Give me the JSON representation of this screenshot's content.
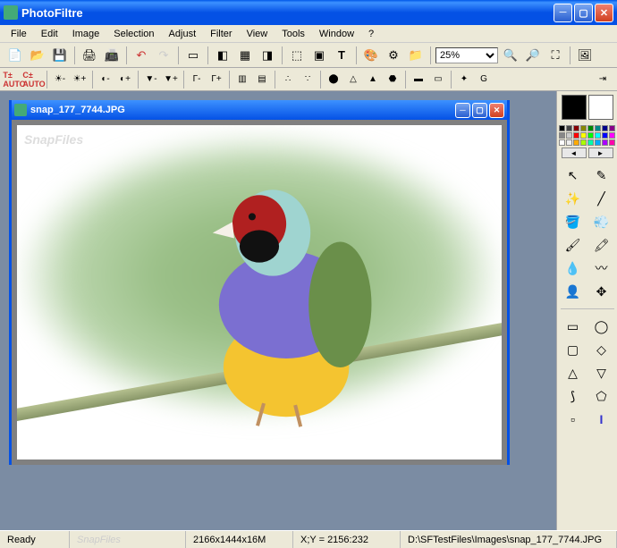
{
  "app": {
    "title": "PhotoFiltre"
  },
  "menu": [
    "File",
    "Edit",
    "Image",
    "Selection",
    "Adjust",
    "Filter",
    "View",
    "Tools",
    "Window",
    "?"
  ],
  "zoom": {
    "value": "25%"
  },
  "document": {
    "title": "snap_177_7744.JPG",
    "watermark": "SnapFiles"
  },
  "colors": {
    "foreground": "#000000",
    "background": "#ffffff"
  },
  "palette_colors": [
    "#000",
    "#444",
    "#800",
    "#880",
    "#080",
    "#088",
    "#008",
    "#808",
    "#888",
    "#ccc",
    "#f00",
    "#ff0",
    "#0f0",
    "#0ff",
    "#00f",
    "#f0f",
    "#fff",
    "#eee",
    "#fa0",
    "#af0",
    "#0fa",
    "#0af",
    "#a0f",
    "#f0a"
  ],
  "status": {
    "ready": "Ready",
    "dimensions": "2166x1444x16M",
    "xy": "X;Y = 2156:232",
    "path": "D:\\SFTestFiles\\Images\\snap_177_7744.JPG"
  }
}
